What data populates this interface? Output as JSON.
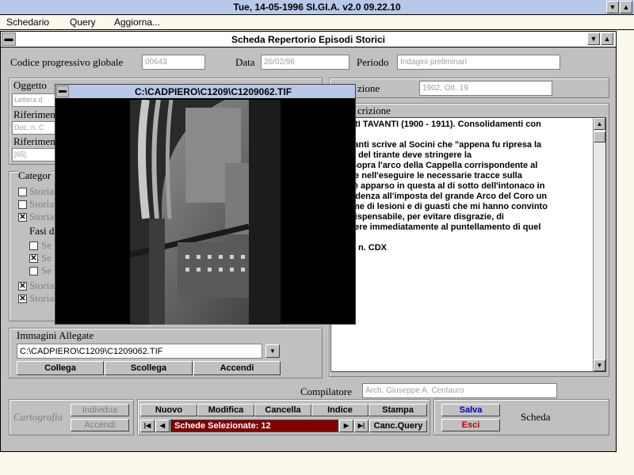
{
  "app": {
    "title": "Tue, 14-05-1996    SI.GI.A.  v2.0    09.22.10"
  },
  "menu": {
    "items": [
      "Schedario",
      "Query",
      "Aggiorna..."
    ]
  },
  "window": {
    "title": "Scheda Repertorio Episodi Storici"
  },
  "form": {
    "codice_label": "Codice progressivo globale",
    "codice_value": "00643",
    "data_label": "Data",
    "data_value": "20/02/96",
    "periodo_label": "Periodo",
    "periodo_value": "Indagini preliminari",
    "oggetto_label": "Oggetto",
    "oggetto_value": "Lettera d",
    "riferimento1_label": "Riferimen",
    "riferimento1_value": "Doc. n. C",
    "riferimento2_label": "Riferimen",
    "riferimento2_value": "[65].",
    "collocazione_label": "zione",
    "collocazione_value": "1902, Ott. 19",
    "descrizione_label": "crizione",
    "descrizione_text": "TAURI TAVANTI (1900 - 1911). Consolidamenti con\nne.\n. Tavanti scrive al Socini che \"appena fu ripresa la\natura del tirante deve stringere la\nglia sopra l'arco della Cappella corrispondente al\nnile, e nell'eseguire le necessarie tracce sulla\ntura è apparso in questa al di sotto dell'intonaco in\nspondenza all'imposta del grande Arco del Coro un\nnsieme di lesioni e di guasti che mi hanno convinto\ne indispensabile, per evitare disgrazie, di\nvvedere immediatamente al puntellamento di quel\ntro.\"\n Doc. n. CDX",
    "categorie_label": "Categor",
    "categorie_items": [
      {
        "text": "Storia",
        "checked": false
      },
      {
        "text": "Storia",
        "checked": false
      },
      {
        "text": "Storia",
        "checked": true
      }
    ],
    "fasi_label": "Fasi d",
    "fasi_items": [
      {
        "text": "Se",
        "checked": false
      },
      {
        "text": "Se",
        "checked": true
      },
      {
        "text": "Se",
        "checked": false
      }
    ],
    "storia_items": [
      {
        "text": "Storia",
        "checked": true
      },
      {
        "text": "Storia",
        "checked": true
      }
    ],
    "immagini_label": "Immagini Allegate",
    "immagini_value": "C:\\CADPIERO\\C1209\\C1209062.TIF",
    "collega": "Collega",
    "scollega": "Scollega",
    "accendi": "Accendi",
    "compilatore_label": "Compilatore",
    "compilatore_value": "Arch. Giuseppe A. Centauro"
  },
  "toolbar": {
    "cartografia": "Cartografia",
    "individua": "Individua",
    "accendi": "Accendi",
    "nuovo": "Nuovo",
    "modifica": "Modifica",
    "cancella": "Cancella",
    "indice": "Indice",
    "stampa": "Stampa",
    "salva": "Salva",
    "esci": "Esci",
    "scheda": "Scheda",
    "record_status": "Schede Selezionate: 12",
    "canc_query": "Canc.Query"
  },
  "viewer": {
    "title": "C:\\CADPIERO\\C1209\\C1209062.TIF"
  },
  "colors": {
    "titlebar": "#b8c8e8",
    "status_bg": "#800000",
    "salva": "#0000c0",
    "esci": "#c00000"
  }
}
